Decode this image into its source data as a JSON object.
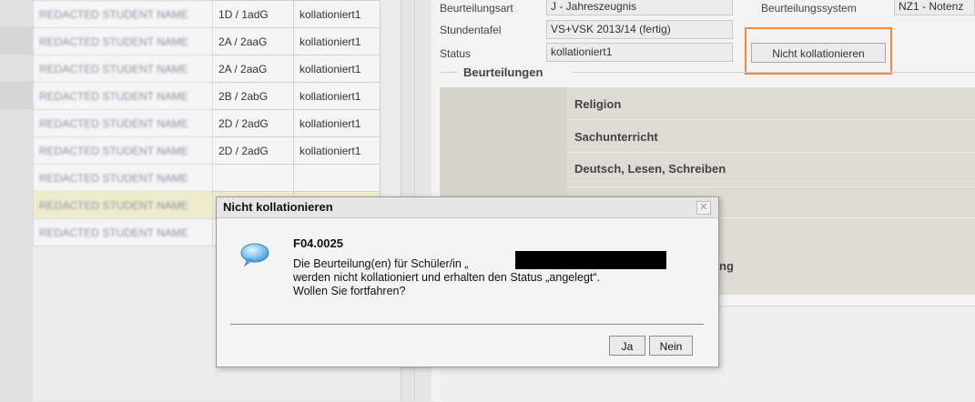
{
  "students": {
    "rows": [
      {
        "name": "REDACTED STUDENT NAME",
        "class": "1D / 1adG",
        "status": "kollationiert1"
      },
      {
        "name": "REDACTED STUDENT NAME",
        "class": "2A / 2aaG",
        "status": "kollationiert1"
      },
      {
        "name": "REDACTED STUDENT NAME",
        "class": "2A / 2aaG",
        "status": "kollationiert1"
      },
      {
        "name": "REDACTED STUDENT NAME",
        "class": "2B / 2abG",
        "status": "kollationiert1"
      },
      {
        "name": "REDACTED STUDENT NAME",
        "class": "2D / 2adG",
        "status": "kollationiert1"
      },
      {
        "name": "REDACTED STUDENT NAME",
        "class": "2D / 2adG",
        "status": "kollationiert1"
      },
      {
        "name": "REDACTED STUDENT NAME",
        "class": "",
        "status": ""
      },
      {
        "name": "REDACTED STUDENT NAME",
        "class": "",
        "status": ""
      },
      {
        "name": "REDACTED STUDENT NAME",
        "class": "",
        "status": ""
      }
    ]
  },
  "details": {
    "beurteilungsart_label": "Beurteilungsart",
    "beurteilungsart_value": "J - Jahreszeugnis",
    "beurteilungssystem_label": "Beurteilungssystem",
    "beurteilungssystem_value": "NZ1 - Notenz",
    "stundentafel_label": "Stundentafel",
    "stundentafel_value": "VS+VSK 2013/14 (fertig)",
    "status_label": "Status",
    "status_value": "kollationiert1",
    "nicht_kollationieren_button": "Nicht kollationieren",
    "section_title": "Beurteilungen",
    "subjects": [
      "Religion",
      "Sachunterricht",
      "Deutsch, Lesen, Schreiben"
    ],
    "partial_subject": "ng"
  },
  "dialog": {
    "title": "Nicht kollationieren",
    "code": "F04.0025",
    "message_line1": "Die Beurteilung(en) für Schüler/in „",
    "message_line2": "werden nicht kollationiert und erhalten den Status „angelegt“.",
    "message_line3": "Wollen Sie fortfahren?",
    "ja_button": "Ja",
    "nein_button": "Nein"
  },
  "colors": {
    "highlight_box": "#f08a3c",
    "highlight_row": "#efeccd"
  }
}
